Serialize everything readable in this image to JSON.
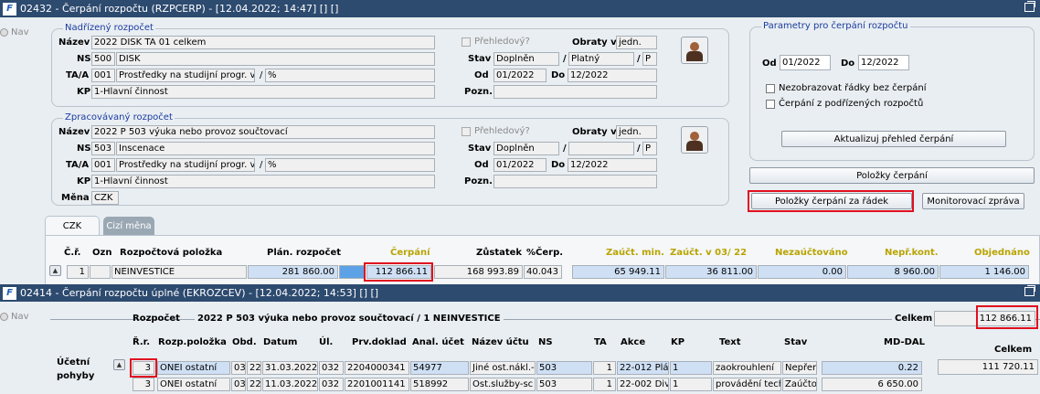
{
  "win1": {
    "title": "02432 - Čerpání rozpočtu (RZPCERP) - [12.04.2022; 14:47]  [] []",
    "nav_label": "Nav",
    "nadrizeny": {
      "group_title": "Nadřízený rozpočet",
      "nazev_label": "Název",
      "nazev_value": "2022 DISK TA 01 celkem",
      "ns_label": "NS",
      "ns_code": "500",
      "ns_name": "DISK",
      "ta_label": "TA/A",
      "ta_code": "001",
      "ta_name": "Prostředky na studijní progr. v",
      "ta_slash": "/",
      "ta_pct": "%",
      "kp_label": "KP",
      "kp_value": "1-Hlavní činnost",
      "prehled_label": "Přehledový?",
      "obraty_label": "Obraty v",
      "obraty_value": "jedn.",
      "stav_label": "Stav",
      "stav_value": "Doplněn",
      "stav_slash": "/",
      "stav_value2": "Platný",
      "stav_slash2": "/",
      "stav_p": "P",
      "od_label": "Od",
      "od_value": "01/2022",
      "do_label": "Do",
      "do_value": "12/2022",
      "pozn_label": "Pozn.",
      "pozn_value": ""
    },
    "zpracovavany": {
      "group_title": "Zpracovávaný rozpočet",
      "nazev_label": "Název",
      "nazev_value": "2022 P 503 výuka nebo provoz součtovací",
      "ns_label": "NS",
      "ns_code": "503",
      "ns_name": "Inscenace",
      "ta_label": "TA/A",
      "ta_code": "001",
      "ta_name": "Prostředky na studijní progr. v",
      "ta_slash": "/",
      "ta_pct": "%",
      "kp_label": "KP",
      "kp_value": "1-Hlavní činnost",
      "mena_label": "Měna",
      "mena_value": "CZK",
      "prehled_label": "Přehledový?",
      "obraty_label": "Obraty v",
      "obraty_value": "jedn.",
      "stav_label": "Stav",
      "stav_value": "Doplněn",
      "stav_slash": "/",
      "stav_value2": "",
      "stav_slash2": "/",
      "stav_p": "P",
      "od_label": "Od",
      "od_value": "01/2022",
      "do_label": "Do",
      "do_value": "12/2022",
      "pozn_label": "Pozn.",
      "pozn_value": ""
    },
    "parametry": {
      "group_title": "Parametry pro čerpání rozpočtu",
      "od_label": "Od",
      "od_value": "01/2022",
      "do_label": "Do",
      "do_value": "12/2022",
      "chk1": "Nezobrazovat řádky bez čerpání",
      "chk2": "Čerpání z podřízených rozpočtů",
      "btn_aktualizuj": "Aktualizuj přehled čerpání"
    },
    "btn_polozky": "Položky čerpání",
    "btn_polozky_radek": "Položky čerpání za řádek",
    "btn_monitor": "Monitorovací zpráva",
    "tabs": [
      "CZK",
      "Cizí měna"
    ],
    "grid": {
      "headers": {
        "cr": "Č.ř.",
        "ozn": "Ozn",
        "polozka": "Rozpočtová položka",
        "plan": "Plán. rozpočet",
        "cerpani": "Čerpání",
        "zustatek": "Zůstatek",
        "pct": "%Čerp.",
        "zauct_min": "Zaúčt. min.",
        "zauct_v": "Zaúčt. v  03/ 22",
        "nezauct": "Nezaúčtováno",
        "nepr": "Nepř.kont.",
        "objed": "Objednáno"
      },
      "row": {
        "cr": "1",
        "ozn": "",
        "polozka": "NEINVESTICE",
        "plan": "281 860.00",
        "cerpani": "112 866.11",
        "zustatek": "168 993.89",
        "pct": "40.043",
        "zauct_min": "65 949.11",
        "zauct_v": "36 811.00",
        "nezauct": "0.00",
        "nepr": "8 960.00",
        "objed": "1 146.00"
      }
    }
  },
  "win2": {
    "title": "02414 - Čerpání rozpočtu úplné (EKROZCEV) - [12.04.2022; 14:53]  [] []",
    "nav_label": "Nav",
    "rozpocet_label": "Rozpočet",
    "rozpocet_value": "2022 P 503 výuka nebo provoz součtovací / 1 NEINVESTICE",
    "celkem_label": "Celkem",
    "celkem_value": "112 866.11",
    "celkem_label2": "Celkem",
    "celkem_value2": "111 720.11",
    "side_label1": "Účetní",
    "side_label2": "pohyby",
    "headers": {
      "rr": "Ř.r.",
      "rozp": "Rozp.položka",
      "obd": "Obd.",
      "datum": "Datum",
      "ul": "Úl.",
      "doklad": "Prv.doklad",
      "anal": "Anal. účet",
      "nazev": "Název účtu",
      "ns": "NS",
      "ta": "TA",
      "akce": "Akce",
      "kp": "KP",
      "text": "Text",
      "stav": "Stav",
      "md": "MD-DAL"
    },
    "rows": [
      {
        "rr": "3",
        "rozp": "ONEI ostatní",
        "obd1": "03",
        "obd2": "22",
        "datum": "31.03.2022",
        "ul": "032",
        "doklad": "2204000341",
        "anal": "54977",
        "nazev": "Jiné ost.nákl.-",
        "ns": "503",
        "ta": "1",
        "akce": "22-012 Plá",
        "kp": "1",
        "text": "zaokrouhlení",
        "stav": "Nepřen",
        "md": "0.22"
      },
      {
        "rr": "3",
        "rozp": "ONEI ostatní",
        "obd1": "03",
        "obd2": "22",
        "datum": "11.03.2022",
        "ul": "032",
        "doklad": "2201001141",
        "anal": "518992",
        "nazev": "Ost.služby-sc",
        "ns": "503",
        "ta": "1",
        "akce": "22-002 Div",
        "kp": "1",
        "text": "provádění tech",
        "stav": "Zaúčto",
        "md": "6 650.00"
      }
    ]
  }
}
